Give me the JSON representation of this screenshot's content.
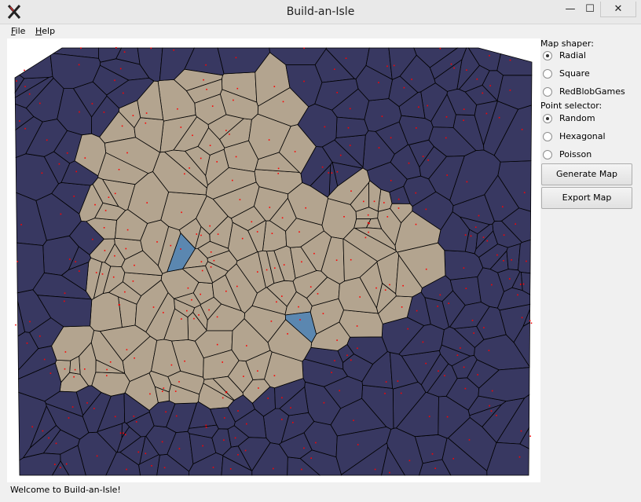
{
  "window": {
    "title": "Build-an-Isle",
    "minimize": "—",
    "maximize": "☐",
    "close": "✕"
  },
  "menu": [
    {
      "label": "File"
    },
    {
      "label": "Help"
    }
  ],
  "sidebar": {
    "map_shaper_label": "Map shaper:",
    "map_shapers": [
      {
        "label": "Radial",
        "selected": true
      },
      {
        "label": "Square",
        "selected": false
      },
      {
        "label": "RedBlobGames",
        "selected": false
      }
    ],
    "point_selector_label": "Point selector:",
    "point_selectors": [
      {
        "label": "Random",
        "selected": true
      },
      {
        "label": "Hexagonal",
        "selected": false
      },
      {
        "label": "Poisson",
        "selected": false
      }
    ],
    "generate_button": "Generate Map",
    "export_button": "Export Map"
  },
  "map": {
    "colors": {
      "ocean": "#383861",
      "land": "#b3a48f",
      "lake": "#5b87b0",
      "edge": "#000000",
      "site": "#ff0000",
      "background": "#ffffff"
    }
  },
  "status": "Welcome to Build-an-Isle!"
}
